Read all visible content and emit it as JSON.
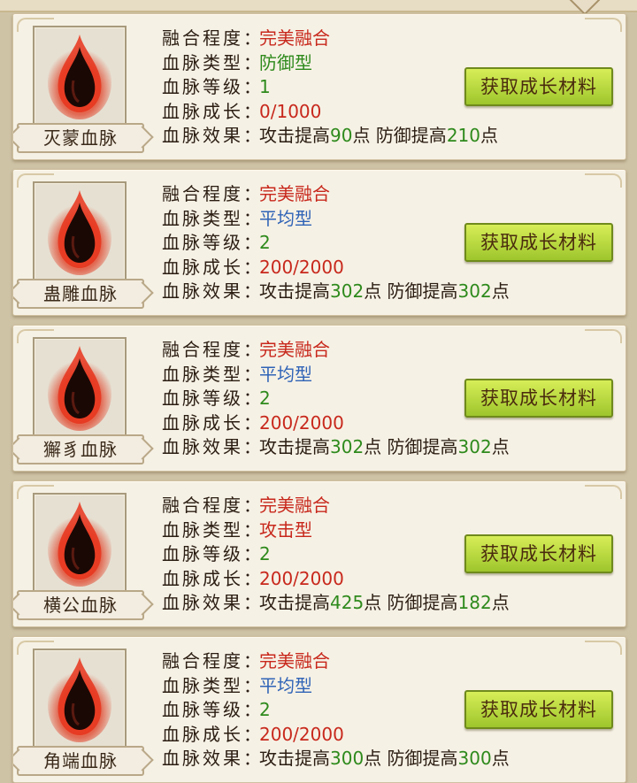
{
  "labels": {
    "fusion": "融合程度",
    "type": "血脉类型",
    "level": "血脉等级",
    "growth": "血脉成长",
    "effect": "血脉效果",
    "colon": "：",
    "atk_prefix": "攻击提高",
    "def_prefix": "防御提高",
    "point": "点"
  },
  "button_label": "获取成长材料",
  "colors": {
    "background": "#cfc3a6",
    "card": "#f6f1e5",
    "red_text": "#c8281c",
    "green_text": "#2e8a1c",
    "blue_text": "#2f63b6",
    "button": "#b8dc3c"
  },
  "bloodlines": [
    {
      "name": "灭蒙血脉",
      "fusion": "完美融合",
      "type": "防御型",
      "type_color": "green",
      "level": "1",
      "growth": "0/1000",
      "atk": "90",
      "def": "210",
      "icon": "blood-drop-icon"
    },
    {
      "name": "蛊雕血脉",
      "fusion": "完美融合",
      "type": "平均型",
      "type_color": "blue",
      "level": "2",
      "growth": "200/2000",
      "atk": "302",
      "def": "302",
      "icon": "blood-drop-icon"
    },
    {
      "name": "獬豸血脉",
      "fusion": "完美融合",
      "type": "平均型",
      "type_color": "blue",
      "level": "2",
      "growth": "200/2000",
      "atk": "302",
      "def": "302",
      "icon": "blood-drop-icon"
    },
    {
      "name": "横公血脉",
      "fusion": "完美融合",
      "type": "攻击型",
      "type_color": "red",
      "level": "2",
      "growth": "200/2000",
      "atk": "425",
      "def": "182",
      "icon": "blood-drop-icon"
    },
    {
      "name": "角端血脉",
      "fusion": "完美融合",
      "type": "平均型",
      "type_color": "blue",
      "level": "2",
      "growth": "200/2000",
      "atk": "300",
      "def": "300",
      "icon": "blood-drop-icon"
    }
  ]
}
